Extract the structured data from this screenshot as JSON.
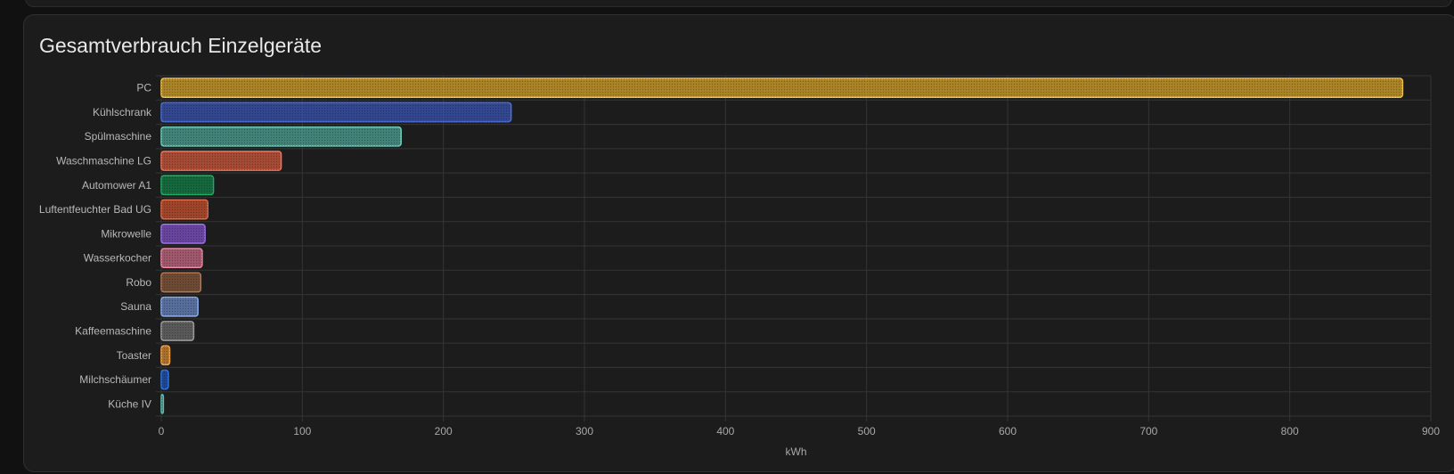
{
  "card": {
    "title": "Gesamtverbrauch Einzelgeräte"
  },
  "chart_data": {
    "type": "bar",
    "orientation": "horizontal",
    "title": "Gesamtverbrauch Einzelgeräte",
    "xlabel": "kWh",
    "ylabel": "",
    "xlim": [
      0,
      900
    ],
    "x_ticks": [
      0,
      100,
      200,
      300,
      400,
      500,
      600,
      700,
      800,
      900
    ],
    "grid": true,
    "categories": [
      "PC",
      "Kühlschrank",
      "Spülmaschine",
      "Waschmaschine LG",
      "Automower A1",
      "Luftentfeuchter Bad UG",
      "Mikrowelle",
      "Wasserkocher",
      "Robo",
      "Sauna",
      "Kaffeemaschine",
      "Toaster",
      "Milchschäumer",
      "Küche IV"
    ],
    "values": [
      880,
      248,
      170,
      85,
      37,
      33,
      31,
      29,
      28,
      26,
      23,
      6,
      5,
      1.5
    ],
    "colors": [
      "#d9a62b",
      "#3a56b5",
      "#4ea597",
      "#d35a3e",
      "#118147",
      "#c95330",
      "#8053c9",
      "#cb6b85",
      "#8a5a3c",
      "#6b88c6",
      "#6d6d6d",
      "#d98b33",
      "#1f56b8",
      "#3e8f83"
    ],
    "edge_colors": [
      "#f2c44c",
      "#4d6ed6",
      "#6fd1be",
      "#f0745a",
      "#1fae63",
      "#e36a44",
      "#9f73ea",
      "#ee8aa6",
      "#b57752",
      "#8cadee",
      "#a0a0a0",
      "#f2a64d",
      "#3173e6",
      "#5fbcae"
    ]
  }
}
